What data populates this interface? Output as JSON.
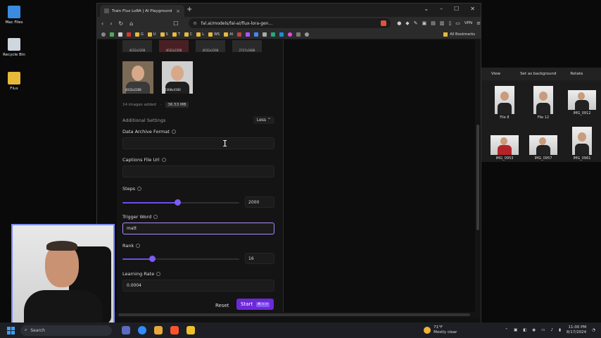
{
  "desktop": {
    "icons": [
      {
        "label": "Mac Files"
      },
      {
        "label": "Recycle Bin"
      },
      {
        "label": "Flux"
      }
    ]
  },
  "bg_window": {
    "toolbar": [
      "View",
      "Set as background",
      "Rotate"
    ],
    "files": [
      "File 8",
      "File 12",
      "IMG_0912",
      "IMG_0953",
      "IMG_0957",
      "IMG_0961"
    ]
  },
  "browser": {
    "tab_title": "Train Flux LoRA | AI Playground",
    "url": "fal.ai/models/fal-ai/flux-lora-gen...",
    "vpn_label": "VPN",
    "bookmarks": [
      "G",
      "U",
      "S",
      "T",
      "C",
      "L",
      "WS",
      "AI"
    ],
    "all_bookmarks": "All Bookmarks"
  },
  "form": {
    "top_photos": [
      "4032x2268",
      "4032x2268",
      "4032x2268",
      "2727x3088"
    ],
    "photos": [
      "4032x2268",
      "2368x4160"
    ],
    "images_added": "14 images added",
    "images_size": "36.53 MB",
    "section_title": "Additional Settings",
    "less_label": "Less",
    "archive_label": "Data Archive Format",
    "captions_label": "Captions File Url",
    "steps_label": "Steps",
    "steps_value": "2000",
    "steps_fraction": 0.47,
    "trigger_label": "Trigger Word",
    "trigger_value": "matt",
    "rank_label": "Rank",
    "rank_value": "16",
    "rank_fraction": 0.25,
    "lr_label": "Learning Rate",
    "lr_value": "0.0004",
    "reset_label": "Reset",
    "start_label": "Start",
    "start_shortcut": "⌘ + ↵"
  },
  "taskbar": {
    "search_placeholder": "Search",
    "temperature": "71°F",
    "weather": "Mostly clear",
    "time": "11:00 PM",
    "date": "8/17/2024"
  }
}
